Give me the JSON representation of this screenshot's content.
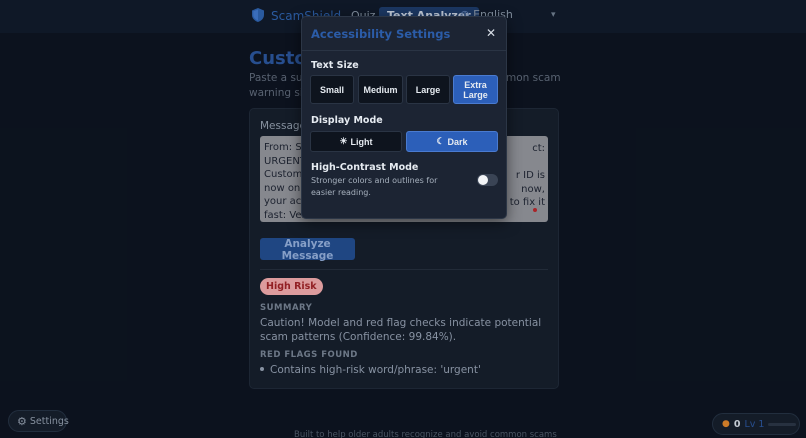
{
  "header": {
    "app_name": "ScamShield",
    "nav": [
      {
        "label": "Quiz",
        "active": false
      },
      {
        "label": "Text Analyzer",
        "active": true
      }
    ],
    "language": "English"
  },
  "page": {
    "title": "Custom",
    "description_left": "Paste a susp",
    "description_right": "mon scam",
    "description_line2": "warning sign"
  },
  "analyzer": {
    "message_label": "Message",
    "message_lines_left": [
      "From: Su",
      "URGENT",
      "Custome",
      "now on",
      "your acc",
      "fast: Ver"
    ],
    "message_lines_right": [
      "ct:",
      "",
      "r ID is",
      "now,",
      "to fix it",
      ""
    ],
    "analyze_label": "Analyze Message",
    "risk_label": "High Risk",
    "summary_label": "SUMMARY",
    "summary_text": "Caution! Model and red flag checks indicate potential scam patterns (Confidence: 99.84%).",
    "red_flags_label": "RED FLAGS FOUND",
    "red_flags": [
      "Contains high-risk word/phrase: 'urgent'"
    ]
  },
  "footer": {
    "text": "Built to help older adults recognize and avoid common scams",
    "settings_label": "Settings",
    "points": "0",
    "level": "Lv 1"
  },
  "modal": {
    "title": "Accessibility Settings",
    "text_size_label": "Text Size",
    "text_sizes": [
      {
        "label": "Small",
        "active": false
      },
      {
        "label": "Medium",
        "active": false
      },
      {
        "label": "Large",
        "active": false
      },
      {
        "label": "Extra Large",
        "active": true
      }
    ],
    "display_mode_label": "Display Mode",
    "modes": [
      {
        "label": "Light",
        "icon": "sun-icon",
        "active": false
      },
      {
        "label": "Dark",
        "icon": "moon-icon",
        "active": true
      }
    ],
    "high_contrast_label": "High-Contrast Mode",
    "high_contrast_desc": "Stronger colors and outlines for easier reading.",
    "high_contrast_on": false
  },
  "colors": {
    "accent": "#2c5fb9",
    "background": "#0d1420",
    "modal_bg": "#1c2433",
    "risk": "#9a2226"
  }
}
